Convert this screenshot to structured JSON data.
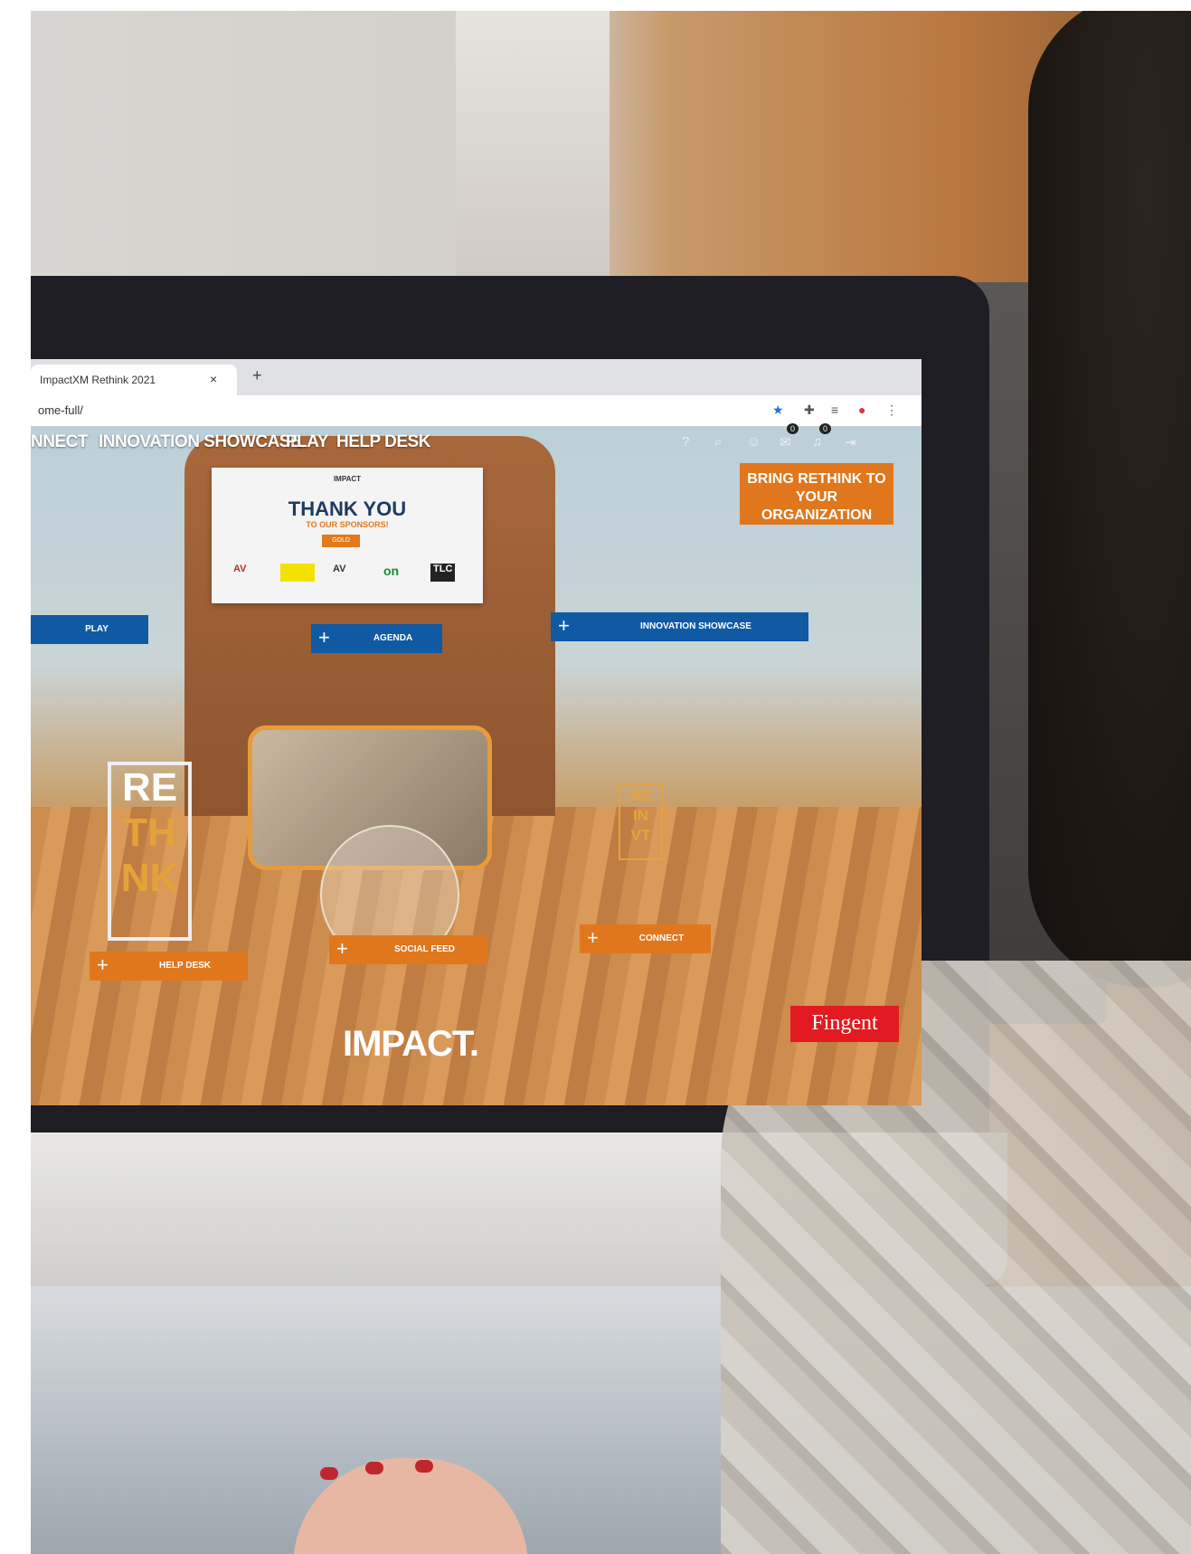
{
  "browser": {
    "tab_title": "ImpactXM Rethink 2021",
    "tab_close": "×",
    "new_tab": "+",
    "address": "ome-full/"
  },
  "nav": {
    "items": [
      "NNECT",
      "INNOVATION SHOWCASE",
      "PLAY",
      "HELP DESK"
    ]
  },
  "header_icons": [
    "help-icon",
    "search-icon",
    "user-icon",
    "mail-icon",
    "bell-icon",
    "logout-icon"
  ],
  "badges": {
    "mail": "0",
    "bell": "0"
  },
  "cta": {
    "label": "BRING RETHINK TO YOUR ORGANIZATION"
  },
  "sponsor_board": {
    "brand": "IMPACT",
    "title": "THANK YOU",
    "subtitle": "TO OUR SPONSORS!",
    "tier": "GOLD",
    "logos": [
      "AV",
      "",
      "AV",
      "on",
      "TLC"
    ]
  },
  "hotspots": {
    "plus": "+",
    "play": "PLAY",
    "agenda": "AGENDA",
    "innovation_showcase": "INNOVATION SHOWCASE",
    "help_desk": "HELP DESK",
    "social_feed": "SOCIAL FEED",
    "connect": "CONNECT"
  },
  "rethink_sign": [
    "RE",
    "TH",
    "NK"
  ],
  "reinvt_sign": [
    "RE",
    "IN",
    "VT"
  ],
  "floor_logo": "IMPACT.",
  "fingent": "Fingent",
  "colors": {
    "orange": "#e0771d",
    "blue": "#0f5aa3",
    "navy": "#1f3a5f"
  }
}
